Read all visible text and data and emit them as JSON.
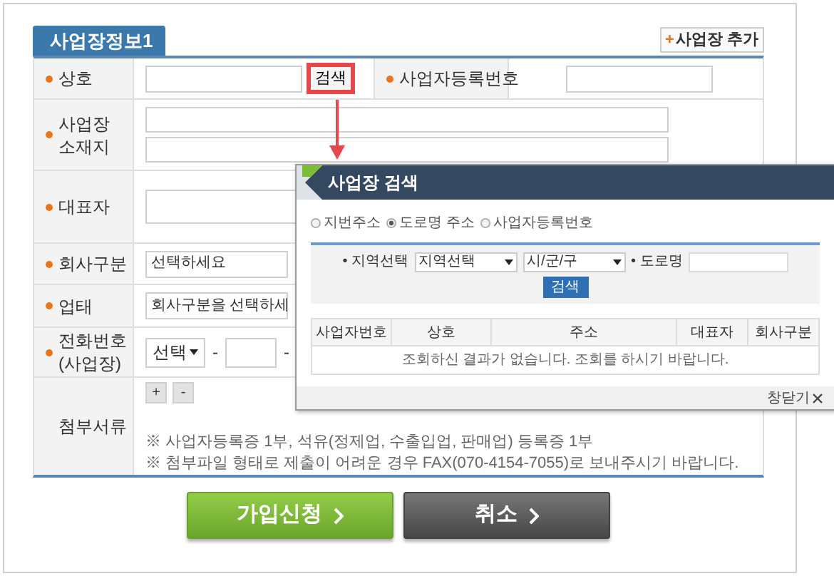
{
  "section": {
    "title": "사업장정보1",
    "add_button": {
      "icon": "+",
      "label": "사업장 추가"
    }
  },
  "rows": [
    {
      "kind": "name",
      "label_lines": [
        "상호"
      ],
      "required": true,
      "button": "검색",
      "highlighted": true,
      "label_2": "사업자등록번호",
      "required_2": true
    },
    {
      "kind": "address",
      "label_lines": [
        "사업장",
        "소재지"
      ],
      "required": true
    },
    {
      "kind": "input",
      "label_lines": [
        "대표자"
      ],
      "required": true
    },
    {
      "kind": "select",
      "label_lines": [
        "회사구분"
      ],
      "required": true,
      "value": "선택하세요"
    },
    {
      "kind": "select",
      "label_lines": [
        "업태"
      ],
      "required": true,
      "value": "회사구분을 선택하세"
    },
    {
      "kind": "phone",
      "label_lines": [
        "전화번호",
        "(사업장)"
      ],
      "required": true,
      "select": "선택",
      "separators": [
        "-",
        "-"
      ]
    },
    {
      "kind": "attachments",
      "label_lines": [
        "첨부서류"
      ],
      "required": false,
      "buttons": [
        "+",
        "-"
      ],
      "notes": [
        "※ 사업자등록증 1부, 석유(정제업, 수출입업, 판매업) 등록증 1부",
        "※ 첨부파일 형태로 제출이 어려운 경우 FAX(070-4154-7055)로 보내주시기 바랍니다."
      ]
    }
  ],
  "buttons": [
    {
      "label": "가입신청",
      "kind": "primary"
    },
    {
      "label": "취소",
      "kind": "secondary"
    }
  ],
  "popup": {
    "title": "사업장 검색",
    "radios": [
      {
        "label": "지번주소",
        "selected": false
      },
      {
        "label": "도로명 주소",
        "selected": true
      },
      {
        "label": "사업자등록번호",
        "selected": false
      }
    ],
    "region_label": "• 지역선택",
    "region_select": "지역선택",
    "district_select": "시/군/구",
    "road_label": "• 도로명",
    "search_button": "검색",
    "columns": [
      "사업자번호",
      "상호",
      "주소",
      "대표자",
      "회사구분"
    ],
    "empty_message": "조회하신 결과가 없습니다. 조회를 하시기 바랍니다.",
    "close": "창닫기"
  }
}
